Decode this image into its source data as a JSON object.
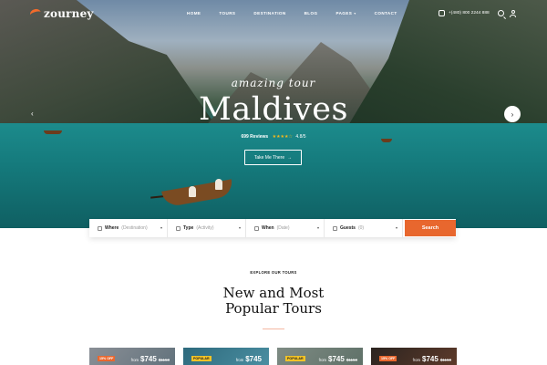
{
  "brand": {
    "name": "zourney",
    "accent": "#e8672e"
  },
  "nav": {
    "items": [
      {
        "label": "HOME",
        "caret": false
      },
      {
        "label": "TOURS",
        "caret": false
      },
      {
        "label": "DESTINATION",
        "caret": false
      },
      {
        "label": "BLOG",
        "caret": false
      },
      {
        "label": "PAGES",
        "caret": true
      },
      {
        "label": "CONTACT",
        "caret": false
      }
    ],
    "phone": "+(480) 800 2244 888",
    "icons": [
      "phone-icon",
      "search-icon",
      "user-icon"
    ]
  },
  "hero": {
    "subtitle": "amazing tour",
    "title": "Maldives",
    "reviews": "699 Reviews",
    "rating": "4.8/5",
    "stars": "★★★★☆",
    "cta": "Take Me There",
    "cta_arrow": "→",
    "prev": "‹",
    "next": "›"
  },
  "search": {
    "fields": [
      {
        "label": "Where",
        "placeholder": "(Destination)",
        "icon": "location-icon"
      },
      {
        "label": "Type",
        "placeholder": "(Activity)",
        "icon": "flag-icon"
      },
      {
        "label": "When",
        "placeholder": "(Date)",
        "icon": "calendar-icon"
      },
      {
        "label": "Guests",
        "placeholder": "(0)",
        "icon": "guests-icon"
      }
    ],
    "button": "Search"
  },
  "section": {
    "kicker": "EXPLORE OUR TOURS",
    "title_line1": "New and Most",
    "title_line2": "Popular Tours"
  },
  "cards": [
    {
      "badge": "15% OFF",
      "badge_type": "off",
      "from": "from",
      "price": "$745",
      "old": "$1150"
    },
    {
      "badge": "POPULAR",
      "badge_type": "popular",
      "from": "from",
      "price": "$745",
      "old": ""
    },
    {
      "badge": "POPULAR",
      "badge_type": "popular",
      "from": "from",
      "price": "$745",
      "old": "$1150"
    },
    {
      "badge": "15% OFF",
      "badge_type": "off",
      "from": "from",
      "price": "$745",
      "old": "$1150"
    }
  ]
}
